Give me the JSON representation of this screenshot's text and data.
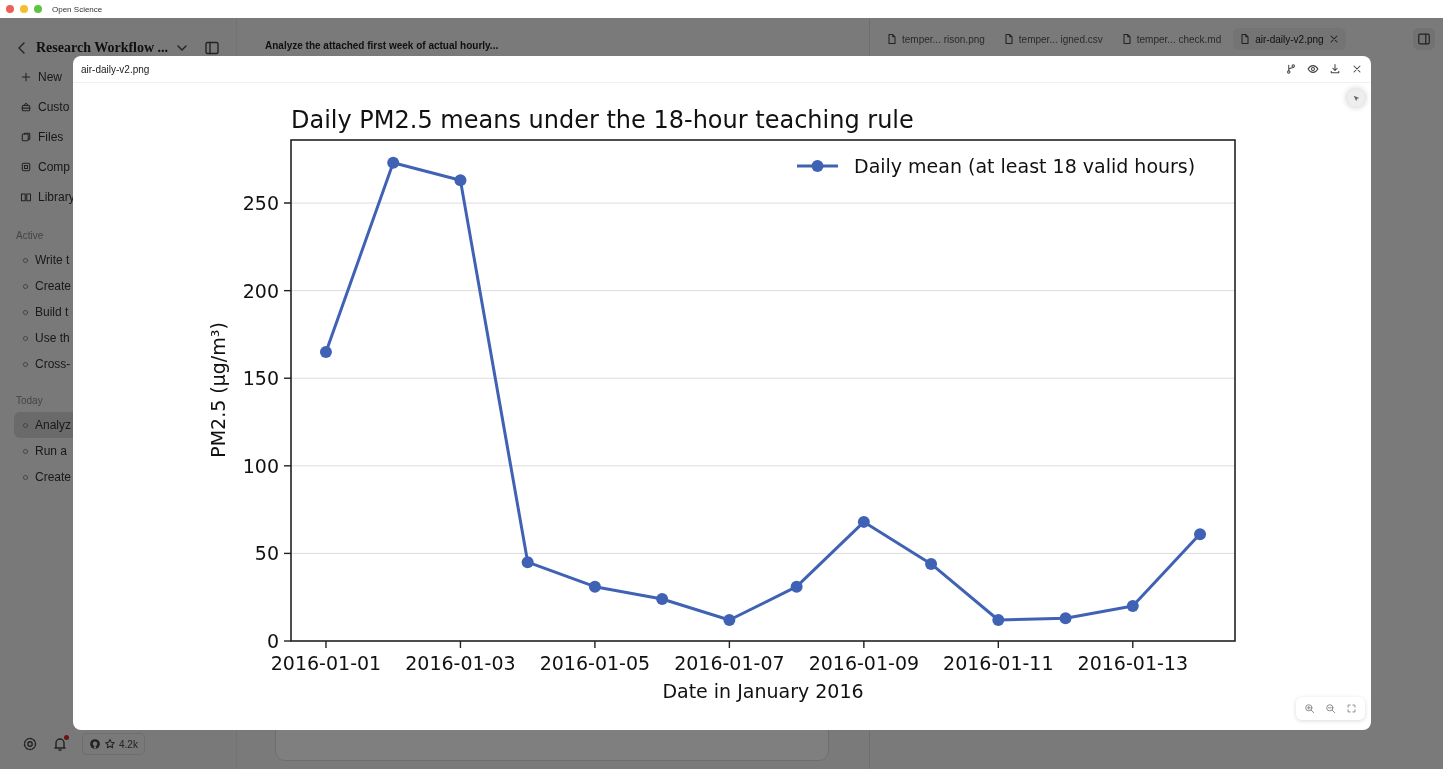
{
  "window": {
    "title": "Open Science"
  },
  "sidebar": {
    "project": "Research Workflow ...",
    "nav": [
      "New",
      "Custo",
      "Files",
      "Comp",
      "Library"
    ],
    "sections": [
      {
        "title": "Active",
        "items": [
          {
            "label": "Write t",
            "selected": false
          },
          {
            "label": "Create",
            "selected": false
          },
          {
            "label": "Build t",
            "selected": false
          },
          {
            "label": "Use th",
            "selected": false
          },
          {
            "label": "Cross-",
            "selected": false
          }
        ]
      },
      {
        "title": "Today",
        "items": [
          {
            "label": "Analyz",
            "selected": true
          },
          {
            "label": "Run a",
            "selected": false
          },
          {
            "label": "Create",
            "selected": false
          }
        ]
      }
    ],
    "footer": {
      "stars": "4.2k",
      "notification": true
    }
  },
  "conversation": {
    "title": "Analyze the attached first week of actual hourly..."
  },
  "file_tabs": [
    {
      "label": "temper... rison.png",
      "selected": false
    },
    {
      "label": "temper... igned.csv",
      "selected": false
    },
    {
      "label": "temper... check.md",
      "selected": false
    },
    {
      "label": "air-daily-v2.png",
      "selected": true
    }
  ],
  "viewer": {
    "filename": "air-daily-v2.png",
    "chart_data": {
      "type": "line",
      "title": "Daily PM2.5 means under the 18-hour teaching rule",
      "xlabel": "Date in January 2016",
      "ylabel": "PM2.5 (μg/m³)",
      "categories": [
        "2016-01-01",
        null,
        "2016-01-03",
        null,
        "2016-01-05",
        null,
        "2016-01-07",
        null,
        "2016-01-09",
        null,
        "2016-01-11",
        null,
        "2016-01-13",
        null
      ],
      "series": [
        {
          "name": "Daily mean (at least 18 valid hours)",
          "color": "#4062b4",
          "marker": "o",
          "values": [
            165,
            273,
            263,
            45,
            31,
            24,
            12,
            31,
            68,
            44,
            12,
            13,
            20,
            61
          ]
        }
      ],
      "ylim": [
        0,
        286
      ],
      "grid": true,
      "yticks": [
        0,
        50,
        100,
        150,
        200,
        250
      ]
    }
  }
}
